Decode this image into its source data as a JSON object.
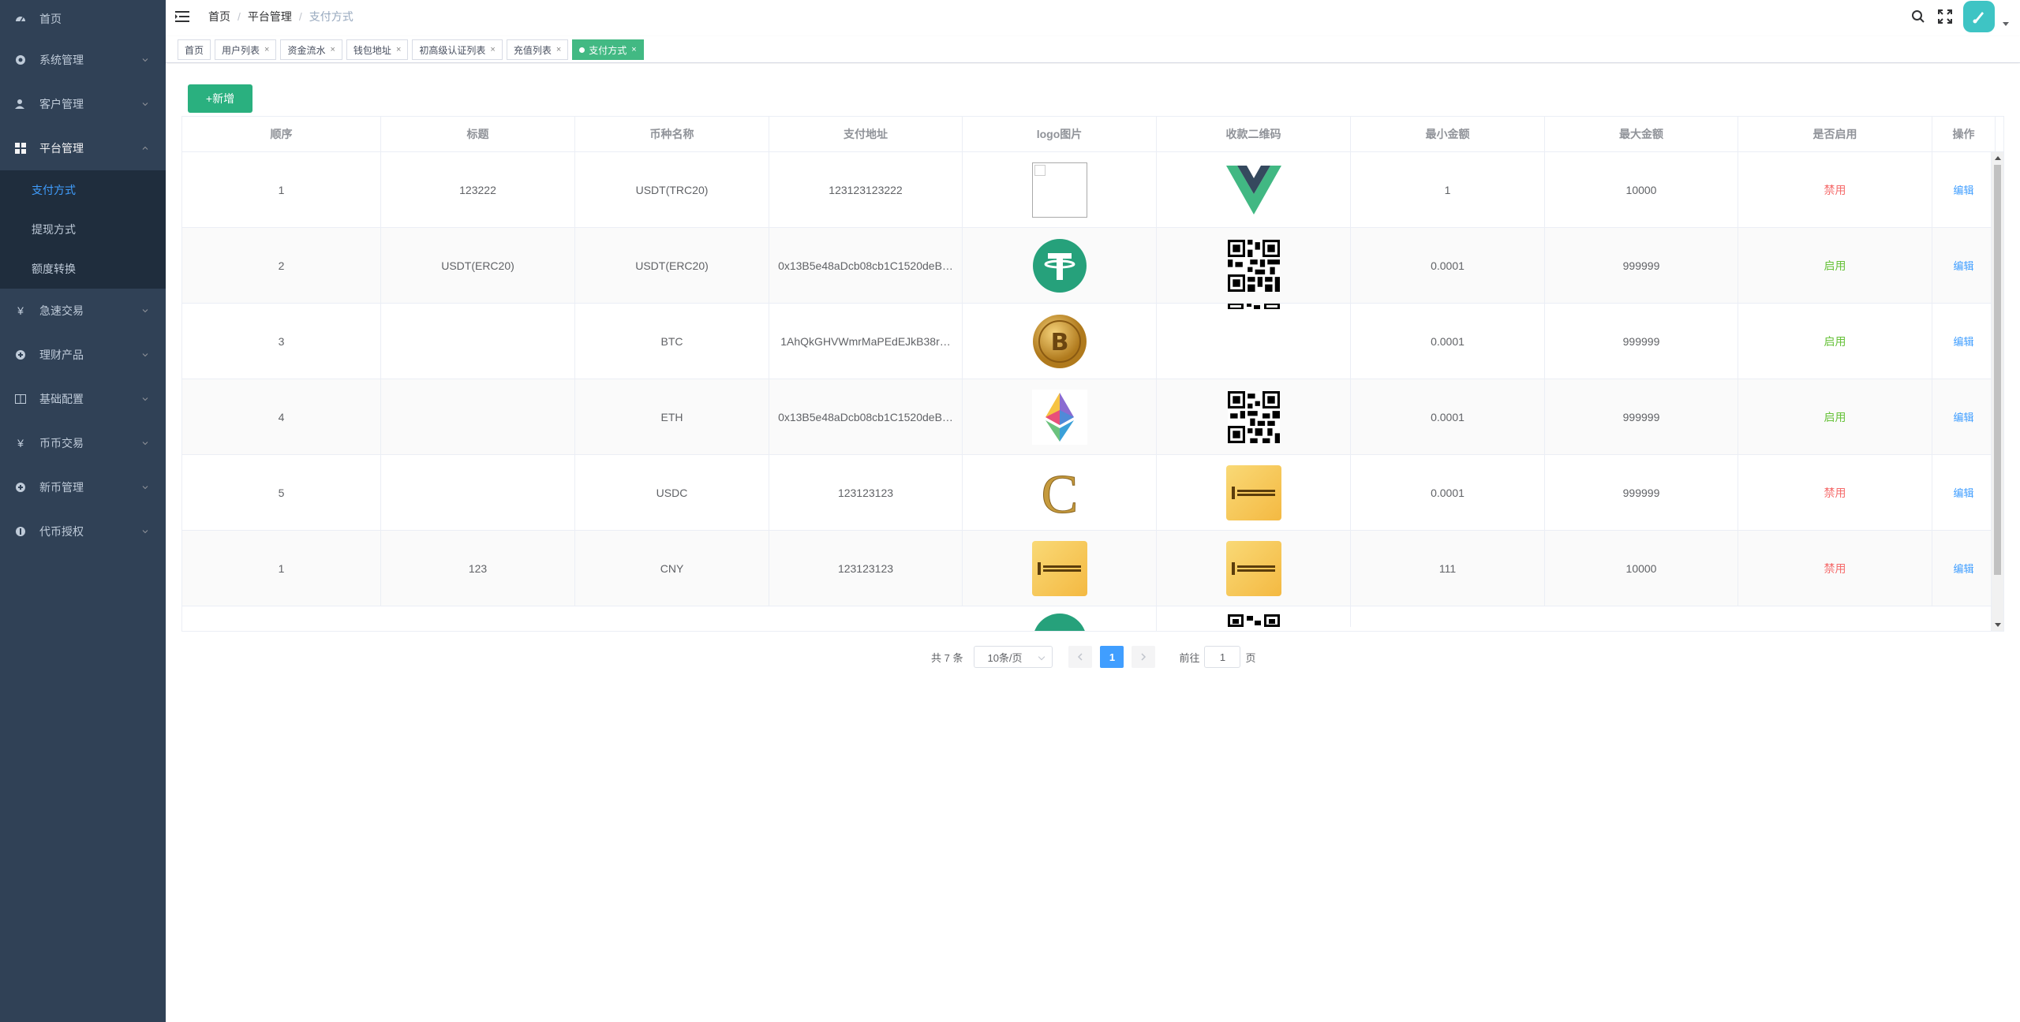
{
  "sidebar": {
    "items": [
      {
        "label": "首页",
        "icon": "dashboard-icon"
      },
      {
        "label": "系统管理",
        "icon": "gear-icon"
      },
      {
        "label": "客户管理",
        "icon": "user-icon"
      },
      {
        "label": "平台管理",
        "icon": "grid-icon"
      },
      {
        "label": "急速交易",
        "icon": "yen-icon"
      },
      {
        "label": "理财产品",
        "icon": "circle-plus-icon"
      },
      {
        "label": "基础配置",
        "icon": "book-icon"
      },
      {
        "label": "币币交易",
        "icon": "yen-icon"
      },
      {
        "label": "新币管理",
        "icon": "circle-plus-icon"
      },
      {
        "label": "代币授权",
        "icon": "badge-icon"
      }
    ],
    "submenu": [
      {
        "label": "支付方式"
      },
      {
        "label": "提现方式"
      },
      {
        "label": "额度转换"
      }
    ]
  },
  "breadcrumb": {
    "home": "首页",
    "section": "平台管理",
    "current": "支付方式"
  },
  "tags": [
    {
      "label": "首页"
    },
    {
      "label": "用户列表"
    },
    {
      "label": "资金流水"
    },
    {
      "label": "钱包地址"
    },
    {
      "label": "初高级认证列表"
    },
    {
      "label": "充值列表"
    },
    {
      "label": "支付方式"
    }
  ],
  "toolbar": {
    "add_label": "+新增"
  },
  "table": {
    "headers": [
      "顺序",
      "标题",
      "币种名称",
      "支付地址",
      "logo图片",
      "收款二维码",
      "最小金额",
      "最大金额",
      "是否启用",
      "操作"
    ],
    "rows": [
      {
        "order": "1",
        "title": "123222",
        "coin": "USDT(TRC20)",
        "address": "123123123222",
        "logo": "broken-image",
        "qr": "vue-logo",
        "min": "1",
        "max": "10000",
        "status": "禁用",
        "status_on": false,
        "action": "编辑"
      },
      {
        "order": "2",
        "title": "USDT(ERC20)",
        "coin": "USDT(ERC20)",
        "address": "0x13B5e48aDcb08cb1C1520deB…",
        "logo": "tether-icon",
        "qr": "qr-code",
        "min": "0.0001",
        "max": "999999",
        "status": "启用",
        "status_on": true,
        "action": "编辑"
      },
      {
        "order": "3",
        "title": "",
        "coin": "BTC",
        "address": "1AhQkGHVWmrMaPEdEJkB38r…",
        "logo": "bitcoin-icon",
        "qr": "qr-partial",
        "min": "0.0001",
        "max": "999999",
        "status": "启用",
        "status_on": true,
        "action": "编辑"
      },
      {
        "order": "4",
        "title": "",
        "coin": "ETH",
        "address": "0x13B5e48aDcb08cb1C1520deB…",
        "logo": "ethereum-icon",
        "qr": "qr-code",
        "min": "0.0001",
        "max": "999999",
        "status": "启用",
        "status_on": true,
        "action": "编辑"
      },
      {
        "order": "5",
        "title": "",
        "coin": "USDC",
        "address": "123123123",
        "logo": "gold-c-icon",
        "qr": "gold-card",
        "min": "0.0001",
        "max": "999999",
        "status": "禁用",
        "status_on": false,
        "action": "编辑"
      },
      {
        "order": "1",
        "title": "123",
        "coin": "CNY",
        "address": "123123123",
        "logo": "gold-card",
        "qr": "gold-card",
        "min": "111",
        "max": "10000",
        "status": "禁用",
        "status_on": false,
        "action": "编辑"
      }
    ]
  },
  "pagination": {
    "total": "共 7 条",
    "page_size": "10条/页",
    "current_page": "1",
    "goto_label": "前往",
    "goto_value": "1",
    "page_unit": "页"
  },
  "colors": {
    "sidebar_bg": "#304156",
    "accent": "#409eff",
    "active_tag": "#42b983",
    "enabled": "#67c23a",
    "disabled": "#f56c6c"
  }
}
